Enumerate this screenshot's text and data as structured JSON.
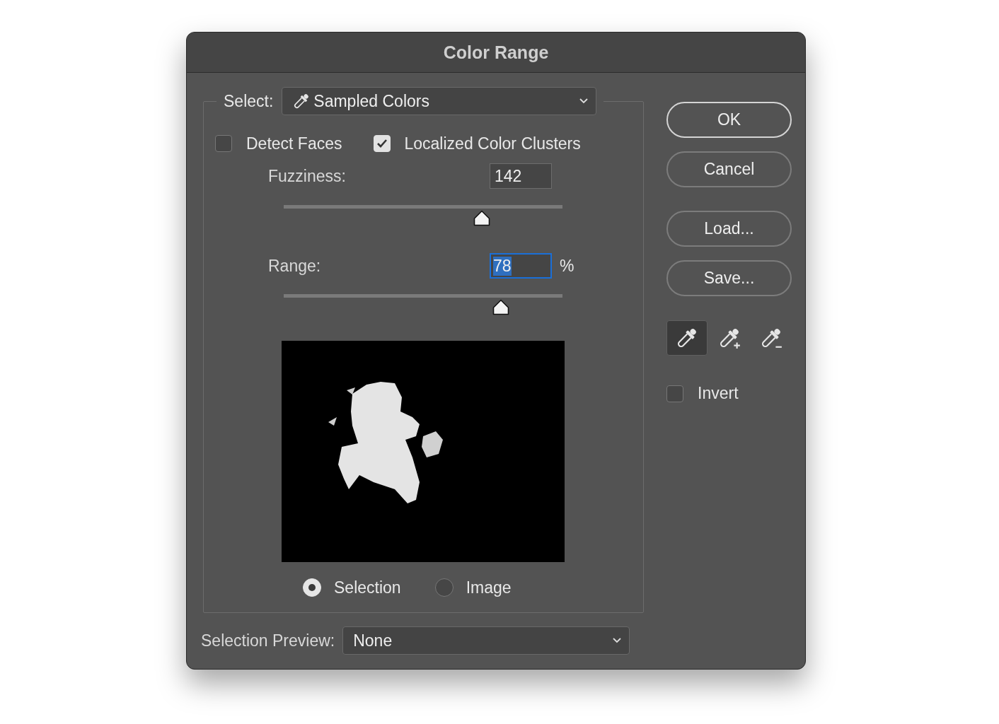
{
  "window": {
    "title": "Color Range"
  },
  "select": {
    "label": "Select:",
    "value": "Sampled Colors"
  },
  "options": [
    {
      "label": "Detect Faces",
      "checked": false
    },
    {
      "label": "Localized Color Clusters",
      "checked": true
    }
  ],
  "fuzziness": {
    "label": "Fuzziness:",
    "value": "142",
    "level": 0.71
  },
  "range": {
    "label": "Range:",
    "value": "78",
    "unit": "%",
    "focused": true,
    "level": 0.78
  },
  "view_modes": [
    {
      "label": "Selection",
      "selected": true
    },
    {
      "label": "Image",
      "selected": false
    }
  ],
  "selection_preview": {
    "label": "Selection Preview:",
    "value": "None"
  },
  "buttons": [
    {
      "label": "OK",
      "default": true
    },
    {
      "label": "Cancel",
      "default": false
    },
    {
      "label": "Load...",
      "default": false
    },
    {
      "label": "Save...",
      "default": false
    }
  ],
  "eyedropper_tools": [
    {
      "kind": "sample",
      "selected": true
    },
    {
      "kind": "add",
      "selected": false
    },
    {
      "kind": "subtract",
      "selected": false
    }
  ],
  "invert": {
    "label": "Invert",
    "checked": false
  }
}
